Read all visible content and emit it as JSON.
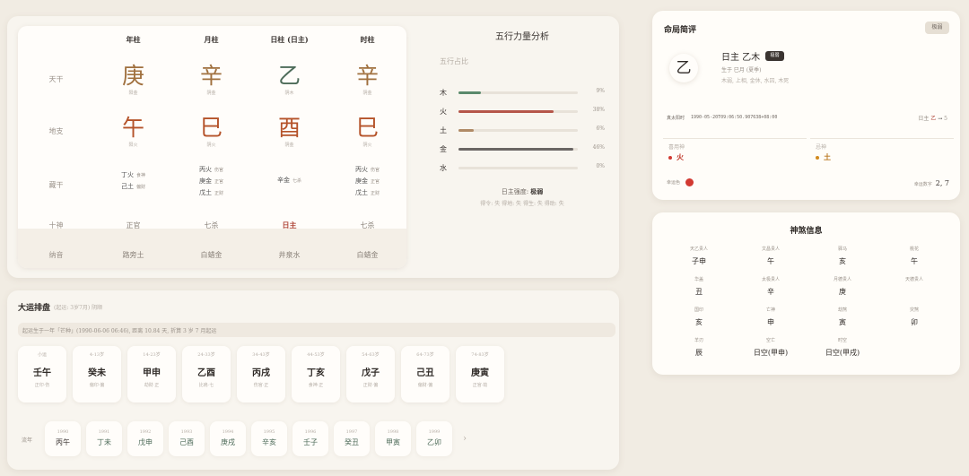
{
  "pillars": {
    "headers": [
      "年柱",
      "月柱",
      "日柱 (日主)",
      "时柱"
    ],
    "row_labels": {
      "tiangan": "天干",
      "dizhi": "地支",
      "canggan": "藏干",
      "shishen": "十神",
      "nayin": "纳音"
    },
    "stems": [
      {
        "char": "庚",
        "sub": "阳金",
        "element": "metal"
      },
      {
        "char": "辛",
        "sub": "阴金",
        "element": "metal"
      },
      {
        "char": "乙",
        "sub": "阴木",
        "element": "wood"
      },
      {
        "char": "辛",
        "sub": "阴金",
        "element": "metal"
      }
    ],
    "branches": [
      {
        "char": "午",
        "sub": "阳火",
        "element": "fire"
      },
      {
        "char": "巳",
        "sub": "阴火",
        "element": "fire"
      },
      {
        "char": "酉",
        "sub": "阴金",
        "element": "metal"
      },
      {
        "char": "巳",
        "sub": "阴火",
        "element": "fire"
      }
    ],
    "hidden": [
      [
        {
          "stem": "丁火",
          "ss": "食神"
        },
        {
          "stem": "己土",
          "ss": "偏财"
        }
      ],
      [
        {
          "stem": "丙火",
          "ss": "伤官"
        },
        {
          "stem": "庚金",
          "ss": "正官"
        },
        {
          "stem": "戊土",
          "ss": "正财"
        }
      ],
      [
        {
          "stem": "辛金",
          "ss": "七杀"
        }
      ],
      [
        {
          "stem": "丙火",
          "ss": "伤官"
        },
        {
          "stem": "庚金",
          "ss": "正官"
        },
        {
          "stem": "戊土",
          "ss": "正财"
        }
      ]
    ],
    "shishen": [
      "正官",
      "七杀",
      "日主",
      "七杀"
    ],
    "nayin": [
      "路旁土",
      "白蜡金",
      "井泉水",
      "白蜡金"
    ]
  },
  "wuxing": {
    "title": "五行力量分析",
    "subtitle": "五行占比",
    "items": [
      {
        "name": "木",
        "pct": 9,
        "pct_label": "9%",
        "color": "#5a8a6c"
      },
      {
        "name": "火",
        "pct": 38,
        "pct_label": "38%",
        "color": "#b5564a"
      },
      {
        "name": "土",
        "pct": 6,
        "pct_label": "6%",
        "color": "#b08a66"
      },
      {
        "name": "金",
        "pct": 46,
        "pct_label": "46%",
        "color": "#6a6664"
      },
      {
        "name": "水",
        "pct": 0,
        "pct_label": "0%",
        "color": "#5a7a9a"
      }
    ],
    "strength_label": "日主强度:",
    "strength_value": "极弱",
    "strength_note": "得令: 失 得地: 失 得生: 失 得助: 失"
  },
  "dayun": {
    "title": "大运排盘",
    "meta": "(起运: 3岁7月)    阴顺",
    "note": "起运生于一年「芒种」(1990-06-06 06:46), 距离 10.84 天, 折算 3 岁 7 月起运",
    "cards": [
      {
        "age": "小运",
        "gz": "壬午",
        "ss": "正印·伤"
      },
      {
        "age": "4-13岁",
        "gz": "癸未",
        "ss": "偏印·偏"
      },
      {
        "age": "14-23岁",
        "gz": "甲申",
        "ss": "劫财·正"
      },
      {
        "age": "24-33岁",
        "gz": "乙酉",
        "ss": "比肩·七"
      },
      {
        "age": "34-43岁",
        "gz": "丙戌",
        "ss": "伤官·正"
      },
      {
        "age": "44-53岁",
        "gz": "丁亥",
        "ss": "食神·正"
      },
      {
        "age": "54-63岁",
        "gz": "戊子",
        "ss": "正财·偏"
      },
      {
        "age": "64-73岁",
        "gz": "己丑",
        "ss": "偏财·偏"
      },
      {
        "age": "74-83岁",
        "gz": "庚寅",
        "ss": "正官·劫"
      }
    ],
    "liunian_label": "流年",
    "liunian": [
      {
        "yr": "1990",
        "gz": "丙午"
      },
      {
        "yr": "1991",
        "gz": "丁未"
      },
      {
        "yr": "1992",
        "gz": "戊申"
      },
      {
        "yr": "1993",
        "gz": "己酉"
      },
      {
        "yr": "1994",
        "gz": "庚戌"
      },
      {
        "yr": "1995",
        "gz": "辛亥"
      },
      {
        "yr": "1996",
        "gz": "壬子"
      },
      {
        "yr": "1997",
        "gz": "癸丑"
      },
      {
        "yr": "1998",
        "gz": "甲寅"
      },
      {
        "yr": "1999",
        "gz": "乙卯"
      }
    ],
    "next_icon": "›"
  },
  "pingjia": {
    "title": "命局简评",
    "badge": "极弱",
    "rizhu_char": "乙",
    "rizhu_name": "日主 乙木",
    "rizhu_tag": "极弱",
    "born": "生于 巳月 (夏季)",
    "status": "木弱, 上相, 金休, 水囚, 木死",
    "zhenshi_label": "真太阳时",
    "zhenshi_value": "1990-05-20T09:06:50.907638+08:00",
    "right_label": "日主",
    "right_yi": "乙",
    "right_arrow": "→",
    "right_num": "5",
    "yongshen_label": "喜用神",
    "yongshen_value": "火",
    "yongshen_color": "#d23a32",
    "jishen_label": "忌神",
    "jishen_value": "土",
    "jishen_color": "#d28a1e",
    "hecai_label": "幸运色",
    "luck_label": "幸运数字",
    "luck_value": "2, 7"
  },
  "shensha": {
    "title": "神煞信息",
    "items": [
      {
        "k": "天乙贵人",
        "v": "子申"
      },
      {
        "k": "文昌贵人",
        "v": "午"
      },
      {
        "k": "驿马",
        "v": "亥"
      },
      {
        "k": "桃花",
        "v": "午"
      },
      {
        "k": "华盖",
        "v": "丑"
      },
      {
        "k": "太极贵人",
        "v": "辛"
      },
      {
        "k": "月德贵人",
        "v": "庚"
      },
      {
        "k": "天德贵人",
        "v": ""
      },
      {
        "k": "国印",
        "v": "亥"
      },
      {
        "k": "亡神",
        "v": "申"
      },
      {
        "k": "劫煞",
        "v": "寅"
      },
      {
        "k": "灾煞",
        "v": "卯"
      },
      {
        "k": "羊刃",
        "v": "辰"
      },
      {
        "k": "空亡",
        "v": "日空(甲申)"
      },
      {
        "k": "时空",
        "v": "日空(甲戌)"
      }
    ]
  }
}
